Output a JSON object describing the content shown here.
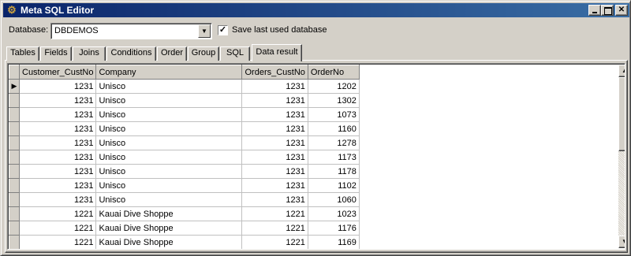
{
  "window": {
    "title": "Meta SQL Editor",
    "icon": "app-icon"
  },
  "database": {
    "label": "Database:",
    "value": "DBDEMOS"
  },
  "save_last": {
    "label": "Save last used database",
    "checked": true
  },
  "tabs": [
    {
      "label": "Tables",
      "active": false
    },
    {
      "label": "Fields",
      "active": false
    },
    {
      "label": "Joins",
      "active": false
    },
    {
      "label": "Conditions",
      "active": false
    },
    {
      "label": "Order",
      "active": false
    },
    {
      "label": "Group",
      "active": false
    },
    {
      "label": "SQL",
      "active": false
    },
    {
      "label": "Data result",
      "active": true
    }
  ],
  "grid": {
    "columns": [
      "Customer_CustNo",
      "Company",
      "Orders_CustNo",
      "OrderNo"
    ],
    "rows": [
      [
        "1231",
        "Unisco",
        "1231",
        "1202"
      ],
      [
        "1231",
        "Unisco",
        "1231",
        "1302"
      ],
      [
        "1231",
        "Unisco",
        "1231",
        "1073"
      ],
      [
        "1231",
        "Unisco",
        "1231",
        "1160"
      ],
      [
        "1231",
        "Unisco",
        "1231",
        "1278"
      ],
      [
        "1231",
        "Unisco",
        "1231",
        "1173"
      ],
      [
        "1231",
        "Unisco",
        "1231",
        "1178"
      ],
      [
        "1231",
        "Unisco",
        "1231",
        "1102"
      ],
      [
        "1231",
        "Unisco",
        "1231",
        "1060"
      ],
      [
        "1221",
        "Kauai Dive Shoppe",
        "1221",
        "1023"
      ],
      [
        "1221",
        "Kauai Dive Shoppe",
        "1221",
        "1176"
      ],
      [
        "1221",
        "Kauai Dive Shoppe",
        "1221",
        "1169"
      ]
    ]
  }
}
